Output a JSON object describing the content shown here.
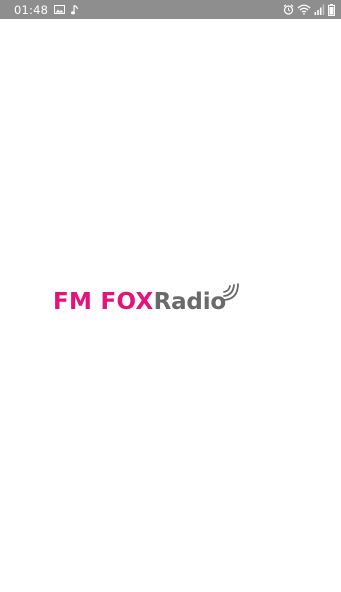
{
  "status_bar": {
    "time": "01:48",
    "icons_left": [
      "image-icon",
      "music-note-icon"
    ],
    "icons_right": [
      "alarm-icon",
      "wifi-icon",
      "signal-icon",
      "battery-icon"
    ],
    "background": "#8e8e8e"
  },
  "logo": {
    "brand": "FM FOX",
    "suffix": "Radio",
    "brand_color": "#e5127a",
    "suffix_color": "#6a6a6a",
    "icon": "radio-waves-icon"
  }
}
